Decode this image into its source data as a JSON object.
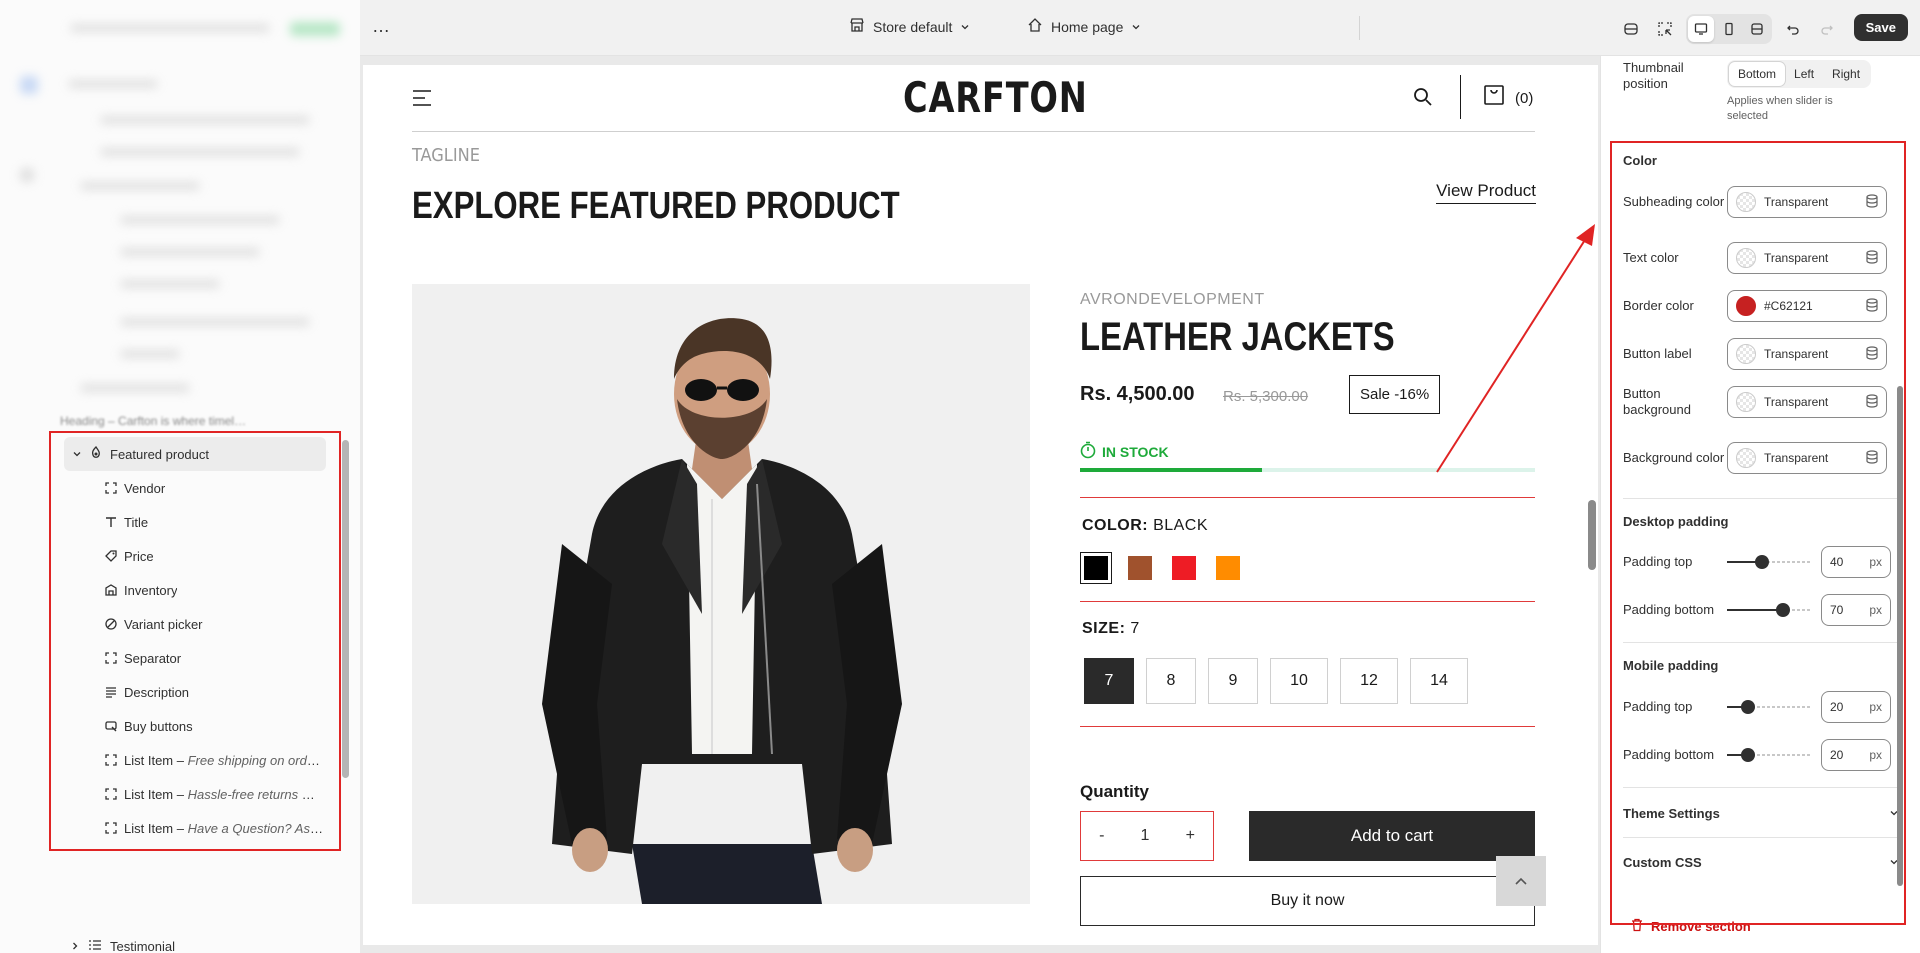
{
  "topbar": {
    "more_label": "…",
    "store_select": "Store default",
    "page_select": "Home page",
    "save_label": "Save"
  },
  "sidebar": {
    "ghost_row": "Heading – Carfton is where timel…",
    "section_title": "Featured product",
    "blocks": [
      {
        "label": "Vendor",
        "icon": "dashed-square-icon"
      },
      {
        "label": "Title",
        "icon": "text-icon"
      },
      {
        "label": "Price",
        "icon": "price-tag-icon"
      },
      {
        "label": "Inventory",
        "icon": "inventory-icon"
      },
      {
        "label": "Variant picker",
        "icon": "variant-icon"
      },
      {
        "label": "Separator",
        "icon": "dashed-square-icon"
      },
      {
        "label": "Description",
        "icon": "text-align-icon"
      },
      {
        "label": "Buy buttons",
        "icon": "cart-click-icon"
      }
    ],
    "list_items": [
      {
        "label": "List Item",
        "detail": "Free shipping on orde…"
      },
      {
        "label": "List Item",
        "detail": "Hassle-free returns w…"
      },
      {
        "label": "List Item",
        "detail": "Have a Question? Ask…"
      }
    ],
    "next_section": "Testimonial"
  },
  "preview": {
    "logo": "CARFTON",
    "cart_count": "(0)",
    "tagline": "TAGLINE",
    "section_title": "EXPLORE FEATURED PRODUCT",
    "view_link": "View Product",
    "vendor": "AVRONDEVELOPMENT",
    "product_title": "LEATHER JACKETS",
    "price": "Rs. 4,500.00",
    "compare_price": "Rs. 5,300.00",
    "sale_badge": "Sale -16%",
    "stock_text": "IN STOCK",
    "stock_level": 0.4,
    "color_label": "COLOR:",
    "color_value": "BLACK",
    "swatches": [
      "#000000",
      "#a0522d",
      "#ee1c25",
      "#ff8c00"
    ],
    "size_label": "SIZE:",
    "size_value": "7",
    "sizes": [
      "7",
      "8",
      "9",
      "10",
      "12",
      "14"
    ],
    "quantity_label": "Quantity",
    "qty_minus": "-",
    "qty_value": "1",
    "qty_plus": "+",
    "add_to_cart": "Add to cart",
    "buy_now": "Buy it now"
  },
  "settings": {
    "thumb_label": "Thumbnail position",
    "thumb_options": [
      "Bottom",
      "Left",
      "Right"
    ],
    "thumb_selected": "Bottom",
    "thumb_help": "Applies when slider is selected",
    "color_section": "Color",
    "colors": [
      {
        "label": "Subheading color",
        "value": "Transparent"
      },
      {
        "label": "Text color",
        "value": "Transparent"
      },
      {
        "label": "Border color",
        "value": "#C62121"
      },
      {
        "label": "Button label",
        "value": "Transparent"
      },
      {
        "label": "Button background",
        "value": "Transparent"
      },
      {
        "label": "Background color",
        "value": "Transparent"
      }
    ],
    "desktop_section": "Desktop padding",
    "desktop_top_label": "Padding top",
    "desktop_top": "40",
    "desktop_bottom_label": "Padding bottom",
    "desktop_bottom": "70",
    "mobile_section": "Mobile padding",
    "mobile_top_label": "Padding top",
    "mobile_top": "20",
    "mobile_bottom_label": "Padding bottom",
    "mobile_bottom": "20",
    "unit": "px",
    "theme_settings": "Theme Settings",
    "custom_css": "Custom CSS",
    "remove_section": "Remove section"
  },
  "colors": {
    "accent_red": "#e02424",
    "border_color": "#C62121",
    "stock_green": "#1eaa3a"
  }
}
